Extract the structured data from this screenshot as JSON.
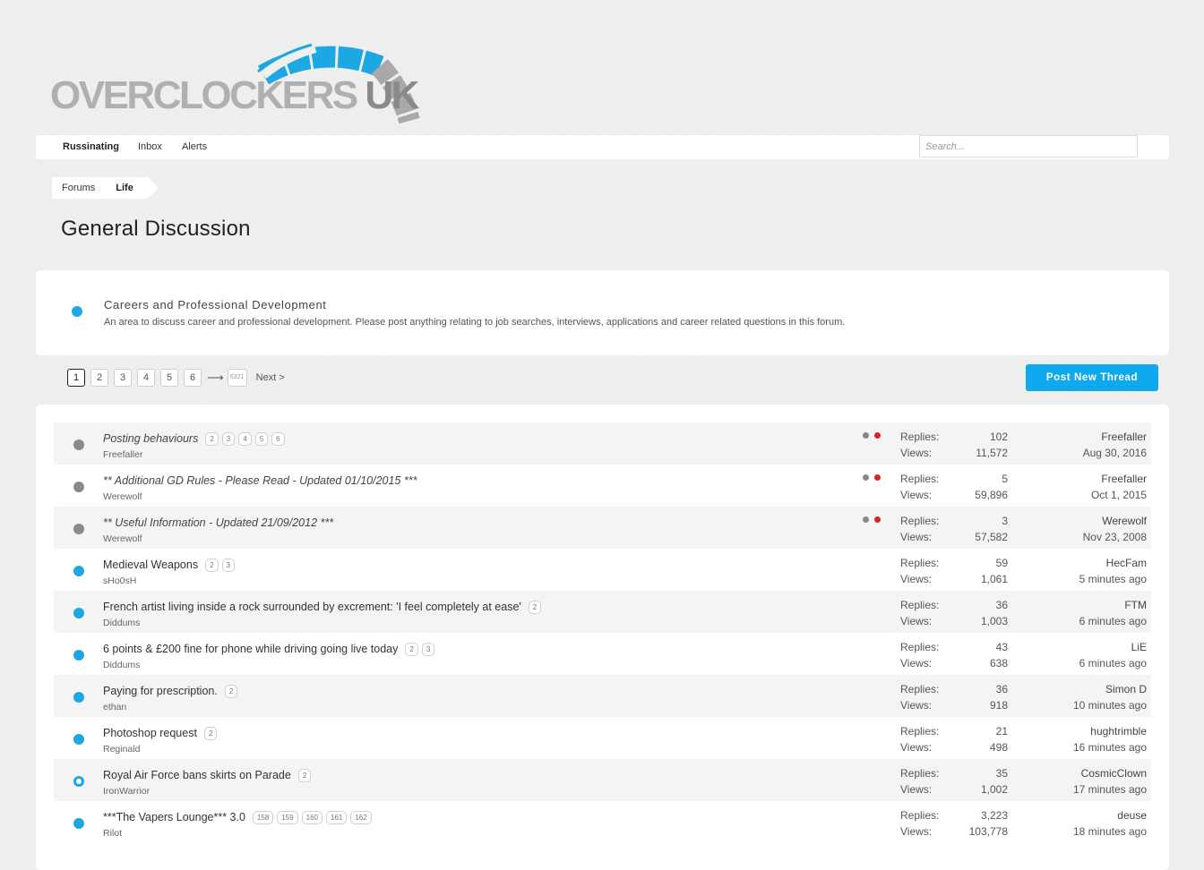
{
  "logo": {
    "text_main": "OVERCLOCKERS",
    "text_suffix": "UK",
    "accent": "#1ea8e3"
  },
  "nav": {
    "user": "Russinating",
    "inbox": "Inbox",
    "alerts": "Alerts",
    "search_placeholder": "Search..."
  },
  "breadcrumb": {
    "root": "Forums",
    "current": "Life"
  },
  "page_title": "General Discussion",
  "subforum": {
    "title": "Careers and Professional Development",
    "description": "An area to discuss career and professional development. Please post anything relating to job searches, interviews, applications and career related questions in this forum."
  },
  "pagination": {
    "pages": [
      "1",
      "2",
      "3",
      "4",
      "5",
      "6"
    ],
    "current": "1",
    "arrow": "⟶",
    "last": "6321",
    "next": "Next >"
  },
  "post_button": "Post New Thread",
  "labels": {
    "replies": "Replies:",
    "views": "Views:"
  },
  "threads": [
    {
      "title": "Posting behaviours",
      "sticky": true,
      "pages": [
        "2",
        "3",
        "4",
        "5",
        "6"
      ],
      "author": "Freefaller",
      "flags": true,
      "status": "grey",
      "replies": "102",
      "views": "11,572",
      "last_user": "Freefaller",
      "last_date": "Aug 30, 2016"
    },
    {
      "title": "** Additional GD Rules - Please Read - Updated 01/10/2015 ***",
      "sticky": true,
      "pages": [],
      "author": "Werewolf",
      "flags": true,
      "status": "grey",
      "replies": "5",
      "views": "59,896",
      "last_user": "Freefaller",
      "last_date": "Oct 1, 2015"
    },
    {
      "title": "** Useful Information - Updated 21/09/2012 ***",
      "sticky": true,
      "pages": [],
      "author": "Werewolf",
      "flags": true,
      "status": "grey",
      "replies": "3",
      "views": "57,582",
      "last_user": "Werewolf",
      "last_date": "Nov 23, 2008"
    },
    {
      "title": "Medieval Weapons",
      "sticky": false,
      "pages": [
        "2",
        "3"
      ],
      "author": "sHo0sH",
      "flags": false,
      "status": "blue",
      "replies": "59",
      "views": "1,061",
      "last_user": "HecFam",
      "last_date": "5 minutes ago"
    },
    {
      "title": "French artist living inside a rock surrounded by excrement: 'I feel completely at ease'",
      "sticky": false,
      "pages": [
        "2"
      ],
      "author": "Diddums",
      "flags": false,
      "status": "blue",
      "replies": "36",
      "views": "1,003",
      "last_user": "FTM",
      "last_date": "6 minutes ago"
    },
    {
      "title": "6 points & £200 fine for phone while driving going live today",
      "sticky": false,
      "pages": [
        "2",
        "3"
      ],
      "author": "Diddums",
      "flags": false,
      "status": "blue",
      "replies": "43",
      "views": "638",
      "last_user": "LiE",
      "last_date": "6 minutes ago"
    },
    {
      "title": "Paying for prescription.",
      "sticky": false,
      "pages": [
        "2"
      ],
      "author": "ethan",
      "flags": false,
      "status": "blue",
      "replies": "36",
      "views": "918",
      "last_user": "Simon D",
      "last_date": "10 minutes ago"
    },
    {
      "title": "Photoshop request",
      "sticky": false,
      "pages": [
        "2"
      ],
      "author": "Reginald",
      "flags": false,
      "status": "blue",
      "replies": "21",
      "views": "498",
      "last_user": "hughtrimble",
      "last_date": "16 minutes ago"
    },
    {
      "title": "Royal Air Force bans skirts on Parade",
      "sticky": false,
      "pages": [
        "2"
      ],
      "author": "IronWarrior",
      "flags": false,
      "status": "ring",
      "replies": "35",
      "views": "1,002",
      "last_user": "CosmicClown",
      "last_date": "17 minutes ago"
    },
    {
      "title": "***The Vapers Lounge*** 3.0",
      "sticky": false,
      "pages": [
        "158",
        "159",
        "160",
        "161",
        "162"
      ],
      "author": "Rilot",
      "flags": false,
      "status": "blue",
      "replies": "3,223",
      "views": "103,778",
      "last_user": "deuse",
      "last_date": "18 minutes ago"
    }
  ]
}
